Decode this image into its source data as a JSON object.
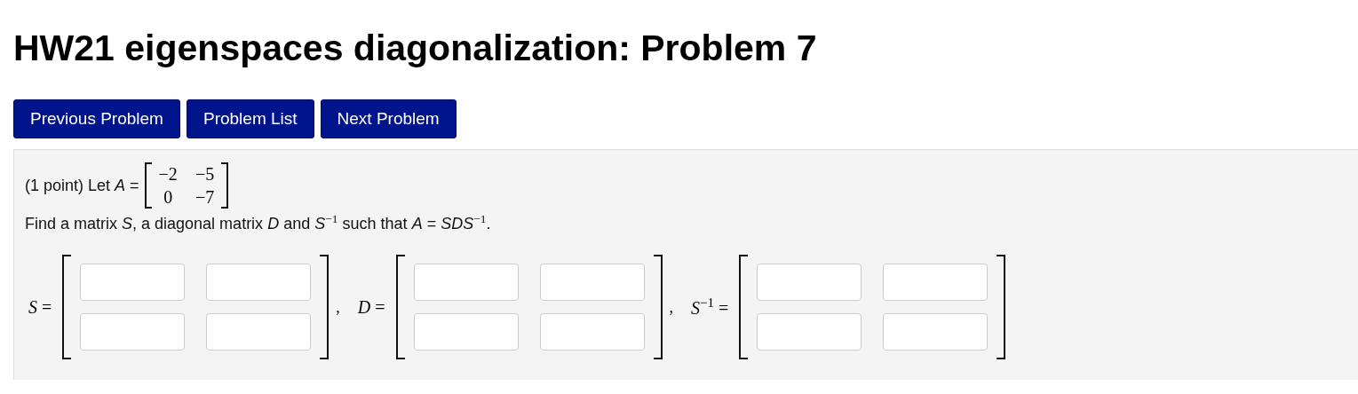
{
  "title": "HW21 eigenspaces diagonalization: Problem 7",
  "nav_buttons": [
    {
      "label": "Previous Problem"
    },
    {
      "label": "Problem List"
    },
    {
      "label": "Next Problem"
    }
  ],
  "problem": {
    "intro": "(1 point) Let *A* =",
    "matrix_a": [
      [
        "−2",
        "−5"
      ],
      [
        "0",
        "−7"
      ]
    ],
    "statement": "Find a matrix *S*, a diagonal matrix *D* and *S*$^{−1}$ such that *A* = *SDS*$^{−1}$.",
    "answers": [
      {
        "label": "*S* =",
        "separator": ",",
        "fields": [
          {
            "kind": "input"
          },
          {
            "kind": "input"
          },
          {
            "kind": "input"
          },
          {
            "kind": "input"
          }
        ]
      },
      {
        "label": "*D* =",
        "separator": ",",
        "fields": [
          {
            "kind": "input"
          },
          {
            "kind": "input"
          },
          {
            "kind": "input"
          },
          {
            "kind": "input"
          }
        ]
      },
      {
        "label": "*S*$^{−1}$ =",
        "fields": [
          {
            "kind": "input"
          },
          {
            "kind": "input"
          },
          {
            "kind": "input"
          },
          {
            "kind": "input"
          }
        ]
      }
    ]
  }
}
